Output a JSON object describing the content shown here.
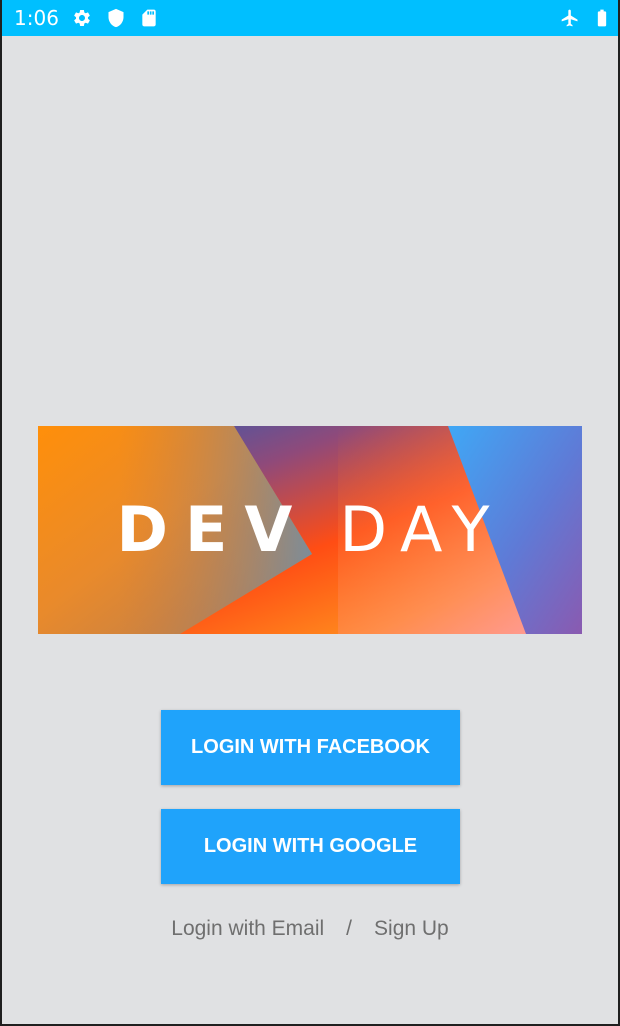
{
  "status_bar": {
    "time": "1:06",
    "left_icons": [
      "gear-icon",
      "shield-icon",
      "sd-card-icon"
    ],
    "right_icons": [
      "airplane-mode-icon",
      "battery-icon"
    ],
    "background_color": "#00bfff"
  },
  "banner": {
    "word_dev": "DEV",
    "word_day": "DAY"
  },
  "buttons": {
    "facebook_label": "LOGIN WITH FACEBOOK",
    "google_label": "LOGIN WITH GOOGLE",
    "color": "#1fa3fb"
  },
  "links": {
    "email_label": "Login with Email",
    "separator": "/",
    "signup_label": "Sign Up"
  },
  "colors": {
    "screen_background": "#e0e1e3",
    "link_text": "#6f6f6f"
  }
}
